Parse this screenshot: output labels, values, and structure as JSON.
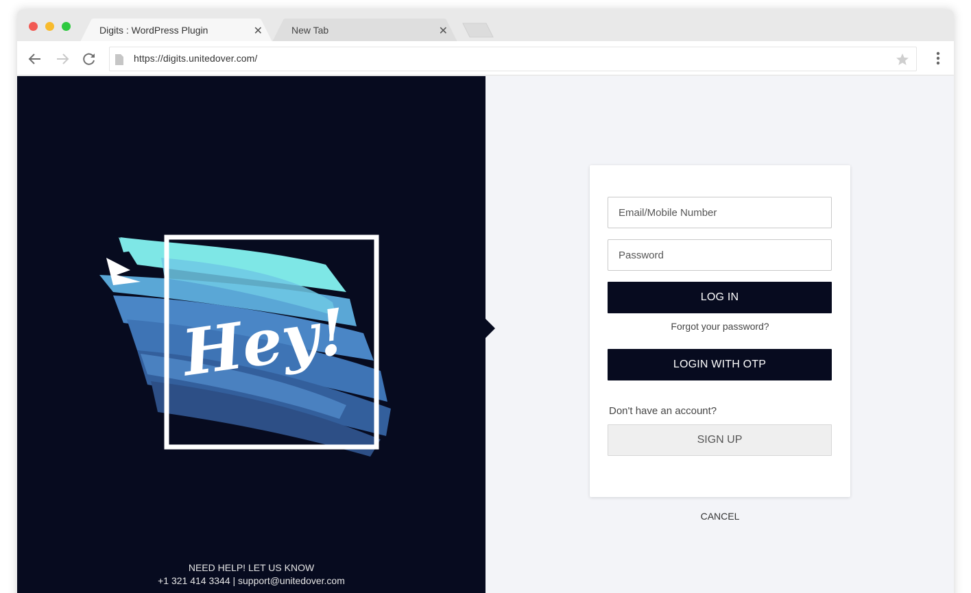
{
  "browser": {
    "tabs": [
      {
        "title": "Digits : WordPress Plugin",
        "active": true
      },
      {
        "title": "New Tab",
        "active": false
      }
    ],
    "url": "https://digits.unitedover.com/"
  },
  "hero": {
    "text": "Hey!"
  },
  "footer": {
    "help_heading": "NEED HELP! LET US KNOW",
    "contact": "+1 321 414 3344 | support@unitedover.com"
  },
  "login": {
    "email_placeholder": "Email/Mobile Number",
    "password_placeholder": "Password",
    "login_label": "LOG IN",
    "forgot_label": "Forgot your password?",
    "otp_label": "LOGIN WITH OTP",
    "no_account_label": "Don't have an account?",
    "signup_label": "SIGN UP",
    "cancel_label": "CANCEL"
  },
  "colors": {
    "dark_navy": "#070b1f",
    "panel_bg": "#f3f4f8",
    "brush_light": "#7ee7e6",
    "brush_mid": "#4a86c6",
    "brush_dark": "#2d4f86"
  },
  "icons": [
    "back-arrow-icon",
    "forward-arrow-icon",
    "reload-icon",
    "page-icon",
    "star-icon",
    "menu-dots-icon",
    "close-icon"
  ]
}
